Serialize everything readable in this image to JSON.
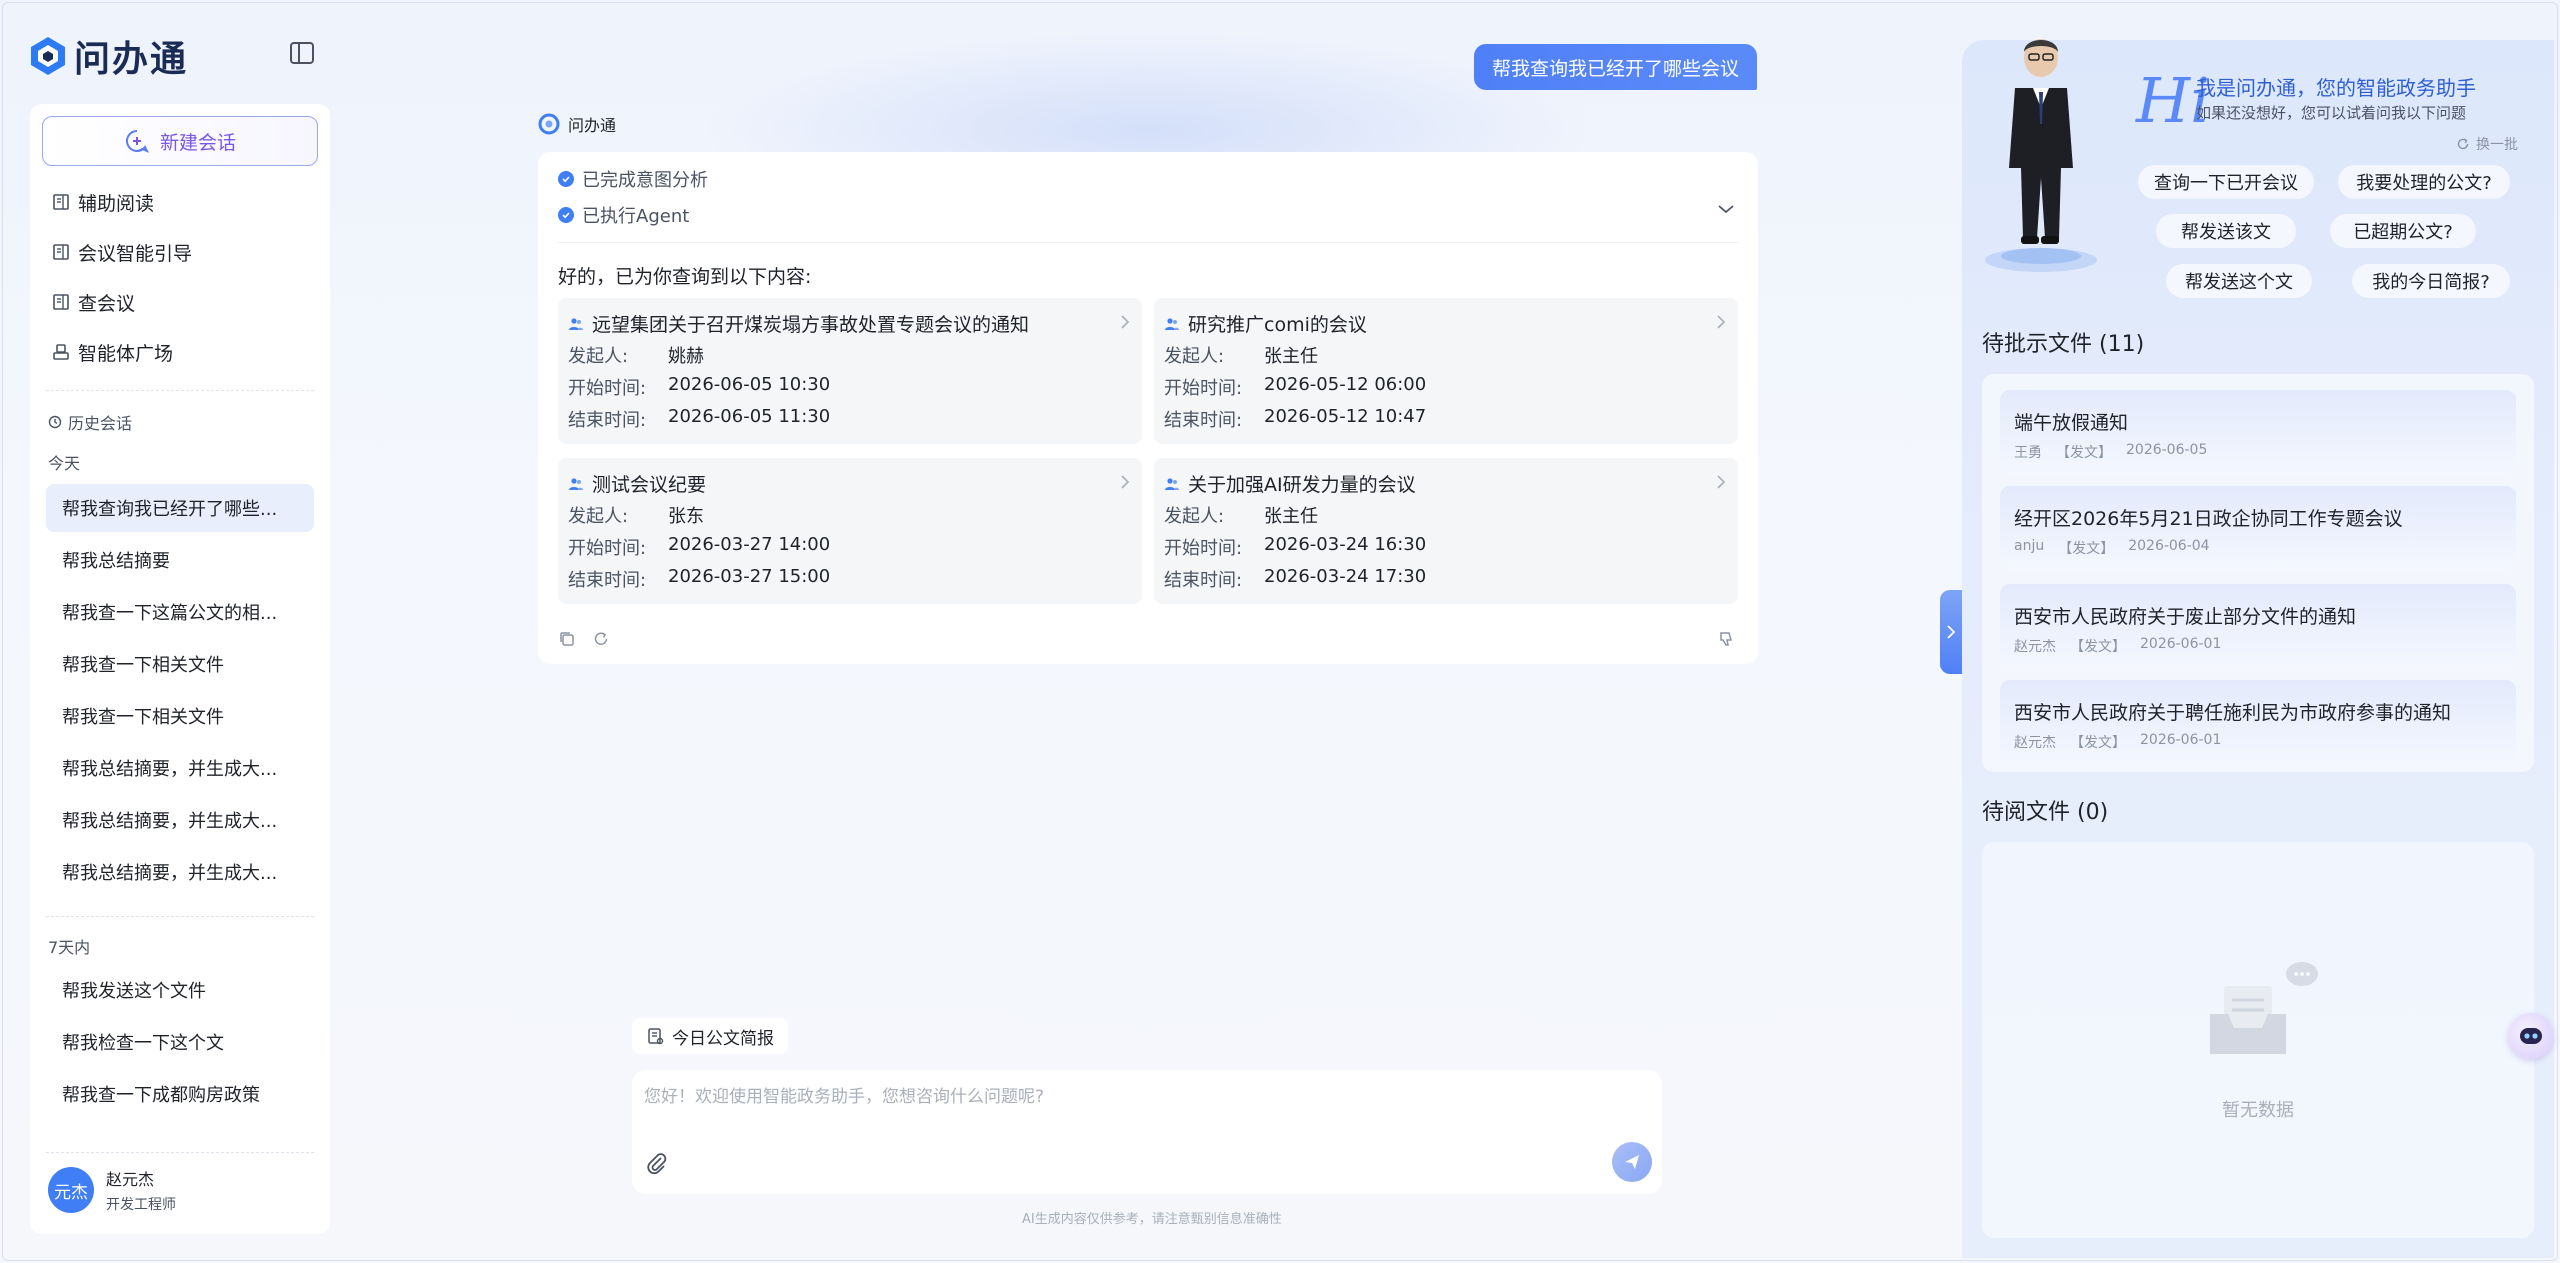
{
  "app": {
    "name": "问办通"
  },
  "sidebar": {
    "new_chat": "新建会话",
    "nav": [
      {
        "label": "辅助阅读",
        "icon": "book-icon"
      },
      {
        "label": "会议智能引导",
        "icon": "book-icon"
      },
      {
        "label": "查会议",
        "icon": "book-icon"
      },
      {
        "label": "智能体广场",
        "icon": "agent-icon"
      }
    ],
    "history_title": "历史会话",
    "groups": [
      {
        "label": "今天",
        "items": [
          "帮我查询我已经开了哪些...",
          "帮我总结摘要",
          "帮我查一下这篇公文的相...",
          "帮我查一下相关文件",
          "帮我查一下相关文件",
          "帮我总结摘要，并生成大...",
          "帮我总结摘要，并生成大...",
          "帮我总结摘要，并生成大..."
        ]
      },
      {
        "label": "7天内",
        "items": [
          "帮我发送这个文件",
          "帮我检查一下这个文",
          "帮我查一下成都购房政策"
        ]
      }
    ],
    "user": {
      "avatar_text": "元杰",
      "name": "赵元杰",
      "role": "开发工程师"
    }
  },
  "chat": {
    "user_message": "帮我查询我已经开了哪些会议",
    "bot_name": "问办通",
    "steps": [
      "已完成意图分析",
      "已执行Agent"
    ],
    "intro": "好的，已为你查询到以下内容:",
    "field_labels": {
      "initiator": "发起人:",
      "start": "开始时间:",
      "end": "结束时间:"
    },
    "meetings": [
      {
        "title": "远望集团关于召开煤炭塌方事故处置专题会议的通知",
        "initiator": "姚赫",
        "start": "2026-06-05 10:30",
        "end": "2026-06-05 11:30"
      },
      {
        "title": "研究推广comi的会议",
        "initiator": "张主任",
        "start": "2026-05-12 06:00",
        "end": "2026-05-12 10:47"
      },
      {
        "title": "测试会议纪要",
        "initiator": "张东",
        "start": "2026-03-27 14:00",
        "end": "2026-03-27 15:00"
      },
      {
        "title": "关于加强AI研发力量的会议",
        "initiator": "张主任",
        "start": "2026-03-24 16:30",
        "end": "2026-03-24 17:30"
      }
    ],
    "briefing_chip": "今日公文简报",
    "input_placeholder": "您好！欢迎使用智能政务助手，您想咨询什么问题呢?",
    "disclaimer": "AI生成内容仅供参考，请注意甄别信息准确性"
  },
  "right_panel": {
    "hi": "Hi",
    "greeting": "我是问办通，您的智能政务助手",
    "sub": "如果还没想好，您可以试着问我以下问题",
    "refresh": "换一批",
    "suggestions": [
      "查询一下已开会议",
      "我要处理的公文?",
      "帮发送该文",
      "已超期公文?",
      "帮发送这个文",
      "我的今日简报?"
    ],
    "pending_title": "待批示文件 (11)",
    "pending": [
      {
        "title": "端午放假通知",
        "author": "王勇",
        "type": "【发文】",
        "date": "2026-06-05"
      },
      {
        "title": "经开区2026年5月21日政企协同工作专题会议",
        "author": "anju",
        "type": "【发文】",
        "date": "2026-06-04"
      },
      {
        "title": "西安市人民政府关于废止部分文件的通知",
        "author": "赵元杰",
        "type": "【发文】",
        "date": "2026-06-01"
      },
      {
        "title": "西安市人民政府关于聘任施利民为市政府参事的通知",
        "author": "赵元杰",
        "type": "【发文】",
        "date": "2026-06-01"
      }
    ],
    "toread_title": "待阅文件 (0)",
    "empty_text": "暂无数据"
  },
  "colors": {
    "accent": "#4f80f7",
    "brand_dark": "#1a2b56",
    "purple": "#7a56e8"
  }
}
